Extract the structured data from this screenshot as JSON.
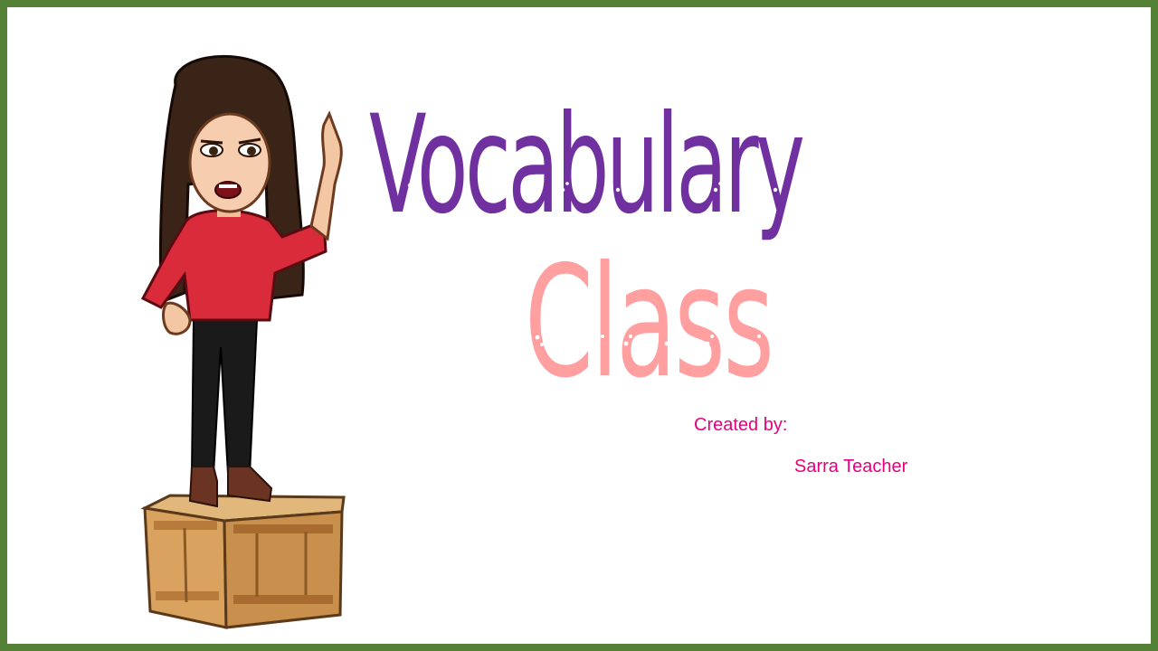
{
  "slide": {
    "title_line_1": "Vocabulary",
    "title_line_2": "Class",
    "credit_label": "Created by:",
    "credit_name": "Sarra Teacher"
  },
  "colors": {
    "border": "#538135",
    "title_line_1": "#7030a0",
    "title_line_2": "#ff9f9f",
    "credit_text": "#e6007e"
  },
  "icons": {
    "avatar": "teacher-on-crate-illustration"
  }
}
